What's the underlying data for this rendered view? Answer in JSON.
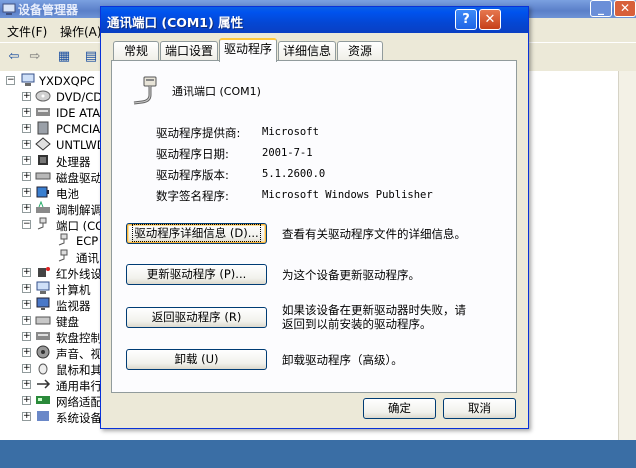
{
  "device_manager": {
    "title": "设备管理器",
    "menu": [
      "文件(F)",
      "操作(A)"
    ],
    "tree": {
      "root": "YXDXQPC",
      "items": [
        "DVD/CD-",
        "IDE ATA/",
        "PCMCIA",
        "UNTLWD",
        "处理器",
        "磁盘驱动",
        "电池",
        "调制解调",
        "端口 (CO",
        "ECP",
        "通讯",
        "红外线设",
        "计算机",
        "监视器",
        "键盘",
        "软盘控制",
        "声音、视",
        "鼠标和其",
        "通用串行",
        "网络适配",
        "系统设备"
      ]
    }
  },
  "dialog": {
    "title": "通讯端口 (COM1) 属性",
    "help": "?",
    "close": "✕",
    "tabs": [
      "常规",
      "端口设置",
      "驱动程序",
      "详细信息",
      "资源"
    ],
    "active_tab": "驱动程序",
    "device_name": "通讯端口 (COM1)",
    "properties": [
      {
        "label": "驱动程序提供商:",
        "value": "Microsoft"
      },
      {
        "label": "驱动程序日期:",
        "value": "2001-7-1"
      },
      {
        "label": "驱动程序版本:",
        "value": "5.1.2600.0"
      },
      {
        "label": "数字签名程序:",
        "value": "Microsoft Windows Publisher"
      }
    ],
    "actions": [
      {
        "button": "驱动程序详细信息 (D)...",
        "desc": "查看有关驱动程序文件的详细信息。"
      },
      {
        "button": "更新驱动程序 (P)...",
        "desc": "为这个设备更新驱动程序。"
      },
      {
        "button": "返回驱动程序 (R)",
        "desc_line1": "如果该设备在更新驱动器时失败，请",
        "desc_line2": "返回到以前安装的驱动程序。"
      },
      {
        "button": "卸载 (U)",
        "desc": "卸载驱动程序（高级）。"
      }
    ],
    "ok": "确定",
    "cancel": "取消"
  }
}
